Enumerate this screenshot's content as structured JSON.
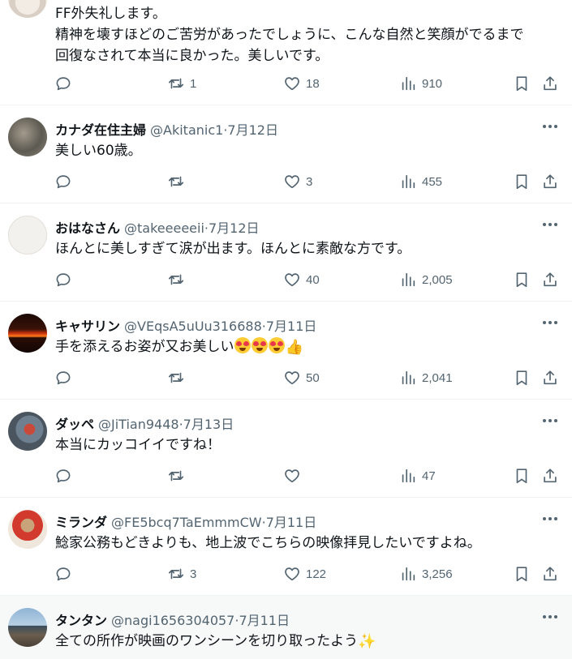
{
  "first_tweet": {
    "text_lines": [
      "FF外失礼します。",
      "精神を壊すほどのご苦労があったでしょうに、こんな自然と笑顔がでるまで",
      "回復なされて本当に良かった。美しいです。"
    ],
    "actions": {
      "replies": "",
      "reposts": "1",
      "likes": "18",
      "views": "910"
    }
  },
  "tweets": [
    {
      "name": "カナダ在住主婦",
      "handle": "@Akitanic1",
      "date": "7月12日",
      "text": "美しい60歳。",
      "actions": {
        "replies": "",
        "reposts": "",
        "likes": "3",
        "views": "455"
      }
    },
    {
      "name": "おはなさん",
      "handle": "@takeeeeeii",
      "date": "7月12日",
      "text": "ほんとに美しすぎて涙が出ます。ほんとに素敵な方です。",
      "actions": {
        "replies": "",
        "reposts": "",
        "likes": "40",
        "views": "2,005"
      }
    },
    {
      "name": "キャサリン",
      "handle": "@VEqsA5uUu316688",
      "date": "7月11日",
      "text": "手を添えるお姿が又お美しい",
      "actions": {
        "replies": "",
        "reposts": "",
        "likes": "50",
        "views": "2,041"
      }
    },
    {
      "name": "ダッペ",
      "handle": "@JiTian9448",
      "date": "7月13日",
      "text": "本当にカッコイイですね！",
      "actions": {
        "replies": "",
        "reposts": "",
        "likes": "",
        "views": "47"
      }
    },
    {
      "name": "ミランダ",
      "handle": "@FE5bcq7TaEmmmCW",
      "date": "7月11日",
      "text": "鯰家公務もどきよりも、地上波でこちらの映像拝見したいですよね。",
      "actions": {
        "replies": "",
        "reposts": "3",
        "likes": "122",
        "views": "3,256"
      }
    },
    {
      "name": "タンタン",
      "handle": "@nagi1656304057",
      "date": "7月11日",
      "text": "全ての所作が映画のワンシーンを切り取ったよう"
    }
  ],
  "separator": " · ",
  "icons": [
    "reply-icon",
    "repost-icon",
    "like-icon",
    "views-icon",
    "bookmark-icon",
    "share-icon",
    "more-icon"
  ]
}
